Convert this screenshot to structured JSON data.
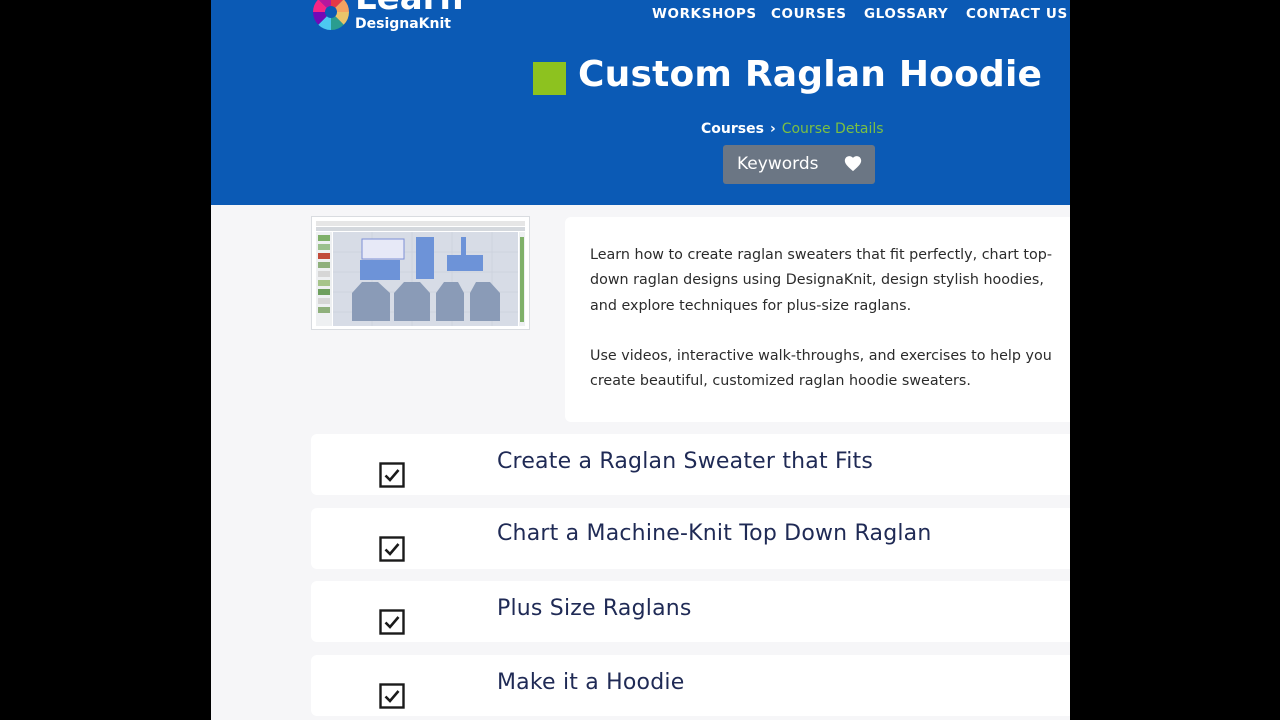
{
  "header": {
    "logo": {
      "word": "Learn",
      "sub": "DesignaKnit"
    },
    "nav": [
      {
        "label": "WORKSHOPS"
      },
      {
        "label": "COURSES"
      },
      {
        "label": "GLOSSARY"
      },
      {
        "label": "CONTACT US"
      }
    ],
    "title": "Custom Raglan Hoodie",
    "breadcrumb": {
      "parent": "Courses",
      "separator": "›",
      "current": "Course Details"
    },
    "keywords_label": "Keywords",
    "colors": {
      "header_bg": "#0b5ab5",
      "title_square": "#8dc21f",
      "breadcrumb_current": "#7bc043",
      "keywords_bg": "#6b7684"
    }
  },
  "description": {
    "paragraphs": [
      "Learn how to create raglan sweaters that fit perfectly, chart top-down raglan designs using DesignaKnit, design stylish hoodies, and explore techniques for plus-size raglans.",
      "Use videos, interactive walk-throughs, and exercises to help you create beautiful, customized raglan hoodie sweaters."
    ]
  },
  "lessons": [
    {
      "title": "Create a Raglan Sweater that Fits",
      "checked": true
    },
    {
      "title": "Chart a Machine-Knit Top Down Raglan",
      "checked": true
    },
    {
      "title": "Plus Size Raglans",
      "checked": true
    },
    {
      "title": "Make it a Hoodie",
      "checked": true
    }
  ]
}
